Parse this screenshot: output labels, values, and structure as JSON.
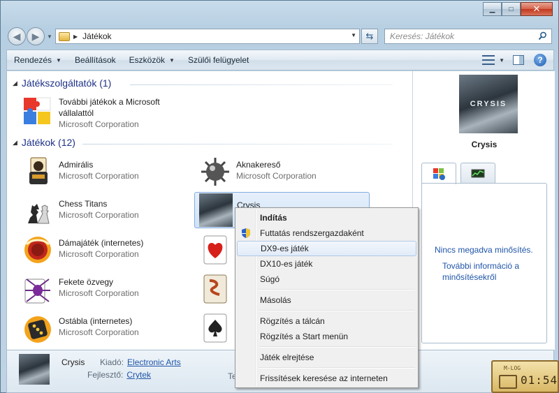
{
  "window": {
    "caption_buttons": {
      "minimize": "▁",
      "maximize": "□",
      "close": "✕"
    }
  },
  "address_bar": {
    "path": "Játékok",
    "search_placeholder": "Keresés: Játékok"
  },
  "toolbar": {
    "items": [
      {
        "label": "Rendezés",
        "dropdown": true
      },
      {
        "label": "Beállítások",
        "dropdown": false
      },
      {
        "label": "Eszközök",
        "dropdown": true
      },
      {
        "label": "Szülői felügyelet",
        "dropdown": false
      }
    ]
  },
  "groups": [
    {
      "label": "Játékszolgáltatók (1)"
    },
    {
      "label": "Játékok (12)"
    }
  ],
  "providers": [
    {
      "name": "További játékok a Microsoft",
      "name2": "vállalattól",
      "publisher": "Microsoft Corporation",
      "icon": "puzzle-icon"
    }
  ],
  "games": [
    {
      "name": "Admirális",
      "publisher": "Microsoft Corporation",
      "icon": "freecell-icon"
    },
    {
      "name": "Aknakereső",
      "publisher": "Microsoft Corporation",
      "icon": "mine-icon"
    },
    {
      "name": "Chess Titans",
      "publisher": "Microsoft Corporation",
      "icon": "chess-icon"
    },
    {
      "name": "Crysis",
      "publisher": "",
      "icon": "crysis-icon"
    },
    {
      "name": "Dámajáték (internetes)",
      "publisher": "Microsoft Corporation",
      "icon": "checkers-icon"
    },
    {
      "name": "Fekete özvegy",
      "publisher": "Microsoft Corporation",
      "icon": "spider-icon"
    },
    {
      "name": "Ostábla (internetes)",
      "publisher": "Microsoft Corporation",
      "icon": "backgammon-icon"
    }
  ],
  "preview": {
    "cover_text": "CRYSIS",
    "title": "Crysis",
    "rating_text": "Nincs megadva minősítés.",
    "more_info": "További információ a minősítésekről"
  },
  "details": {
    "name": "Crysis",
    "publisher_label": "Kiadó:",
    "publisher_value": "Electronic Arts",
    "developer_label": "Fejlesztő:",
    "developer_value": "Crytek",
    "cut_label": "Te"
  },
  "context_menu": {
    "items": [
      {
        "label": "Indítás",
        "bold": true
      },
      {
        "label": "Futtatás rendszergazdaként",
        "shield": true
      },
      {
        "label": "DX9-es játék",
        "highlighted": true
      },
      {
        "label": "DX10-es játék"
      },
      {
        "label": "Súgó"
      },
      {
        "label": "Másolás"
      },
      {
        "label": "Rögzítés a tálcán"
      },
      {
        "label": "Rögzítés a Start menün"
      },
      {
        "label": "Játék elrejtése"
      },
      {
        "label": "Frissítések keresése az interneten"
      }
    ]
  },
  "widget": {
    "label": "M-LOG",
    "time": "01:54"
  }
}
